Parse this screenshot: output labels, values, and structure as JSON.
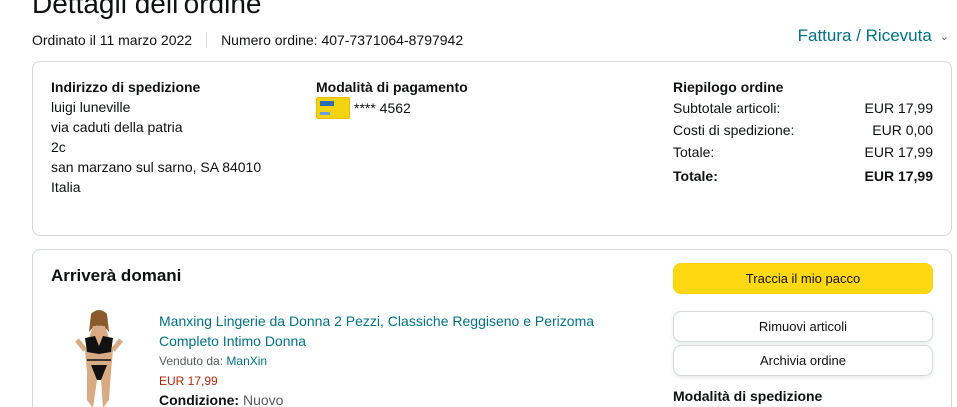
{
  "page": {
    "title": "Dettagli dell'ordine"
  },
  "meta": {
    "ordered": "Ordinato il 11 marzo 2022",
    "order_number": "Numero ordine: 407-7371064-8797942",
    "invoice": "Fattura / Ricevuta"
  },
  "shipping_address": {
    "title": "Indirizzo di spedizione",
    "lines": [
      "luigi luneville",
      "via caduti della patria",
      "2c",
      "san marzano sul sarno, SA 84010",
      "Italia"
    ]
  },
  "payment": {
    "title": "Modalità di pagamento",
    "card_mask": "**** 4562",
    "card_brand_icon": "credit-card-icon"
  },
  "summary": {
    "title": "Riepilogo ordine",
    "rows": [
      {
        "label": "Subtotale articoli:",
        "value": "EUR 17,99"
      },
      {
        "label": "Costi di spedizione:",
        "value": "EUR 0,00"
      },
      {
        "label": "Totale:",
        "value": "EUR 17,99"
      }
    ],
    "grand_total": {
      "label": "Totale:",
      "value": "EUR 17,99"
    }
  },
  "shipment": {
    "status": "Arriverà domani",
    "buttons": {
      "track": "Traccia il mio pacco",
      "remove": "Rimuovi articoli",
      "archive": "Archivia ordine"
    },
    "shipping_mode_title": "Modalità di spedizione"
  },
  "product": {
    "title": "Manxing Lingerie da Donna 2 Pezzi, Classiche Reggiseno e Perizoma Completo Intimo Donna",
    "sold_by_label": "Venduto da:",
    "seller": "ManXin",
    "price": "EUR 17,99",
    "condition_label": "Condizione:",
    "condition": "Nuovo"
  },
  "colors": {
    "link": "#007185",
    "primary_button": "#ffd814",
    "price": "#b12704",
    "border": "#d5d9d9"
  }
}
